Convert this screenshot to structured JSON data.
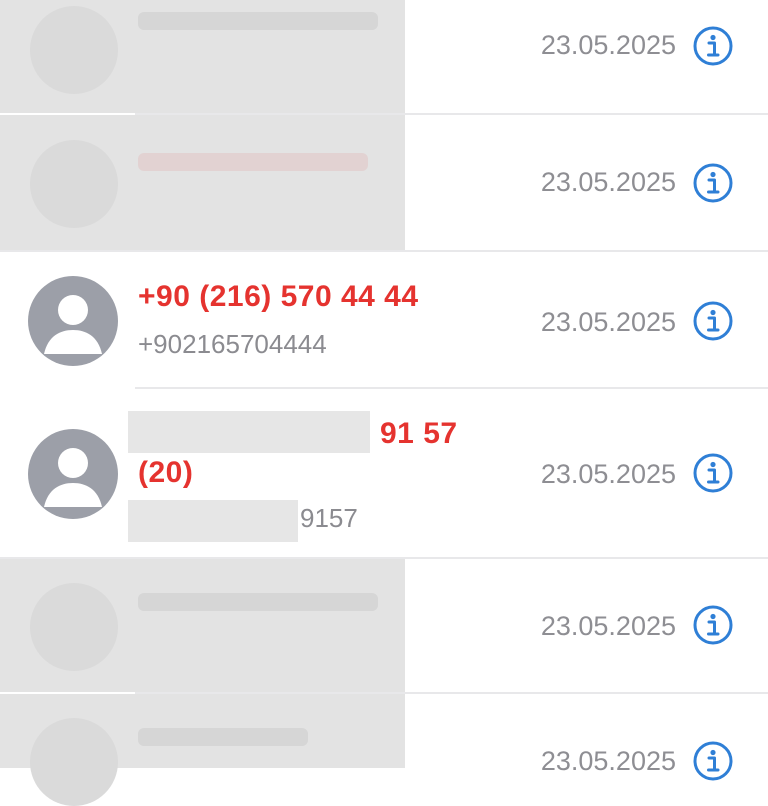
{
  "calls": [
    {
      "date": "23.05.2025",
      "blurred": true
    },
    {
      "date": "23.05.2025",
      "blurred": true
    },
    {
      "date": "23.05.2025",
      "name": "+90 (216) 570 44 44",
      "number": "+902165704444"
    },
    {
      "date": "23.05.2025",
      "name_visible_part1": "91 57",
      "name_visible_part2": "(20)",
      "number_visible_part": "9157"
    },
    {
      "date": "23.05.2025",
      "blurred": true
    },
    {
      "date": "23.05.2025",
      "blurred": true
    }
  ],
  "icons": {
    "info": "info-circle-icon",
    "avatar": "person-placeholder-icon"
  },
  "colors": {
    "missed": "#e5332f",
    "accent": "#2f7fd6",
    "secondary": "#8e8e93"
  }
}
